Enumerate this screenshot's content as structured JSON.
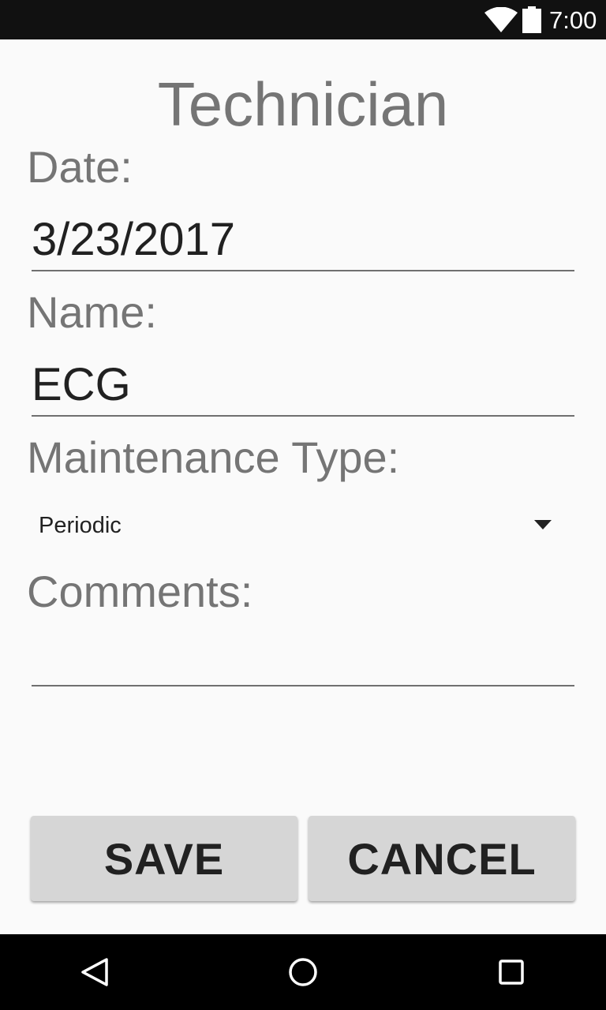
{
  "status_bar": {
    "time": "7:00",
    "icons": [
      "wifi-icon",
      "battery-icon"
    ]
  },
  "form": {
    "title": "Technician",
    "date_label": "Date:",
    "date_value": "3/23/2017",
    "name_label": "Name:",
    "name_value": "ECG",
    "maintenance_label": "Maintenance Type:",
    "maintenance_selected": "Periodic",
    "comments_label": "Comments:",
    "comments_value": ""
  },
  "buttons": {
    "save_label": "SAVE",
    "cancel_label": "CANCEL"
  },
  "nav_bar": {
    "icons": [
      "back-icon",
      "home-icon",
      "recents-icon"
    ]
  },
  "colors": {
    "status_bar": "#111111",
    "background": "#fafafa",
    "label_text": "#757575",
    "value_text": "#212121",
    "button_bg": "#d6d6d6",
    "nav_bar": "#000000"
  }
}
